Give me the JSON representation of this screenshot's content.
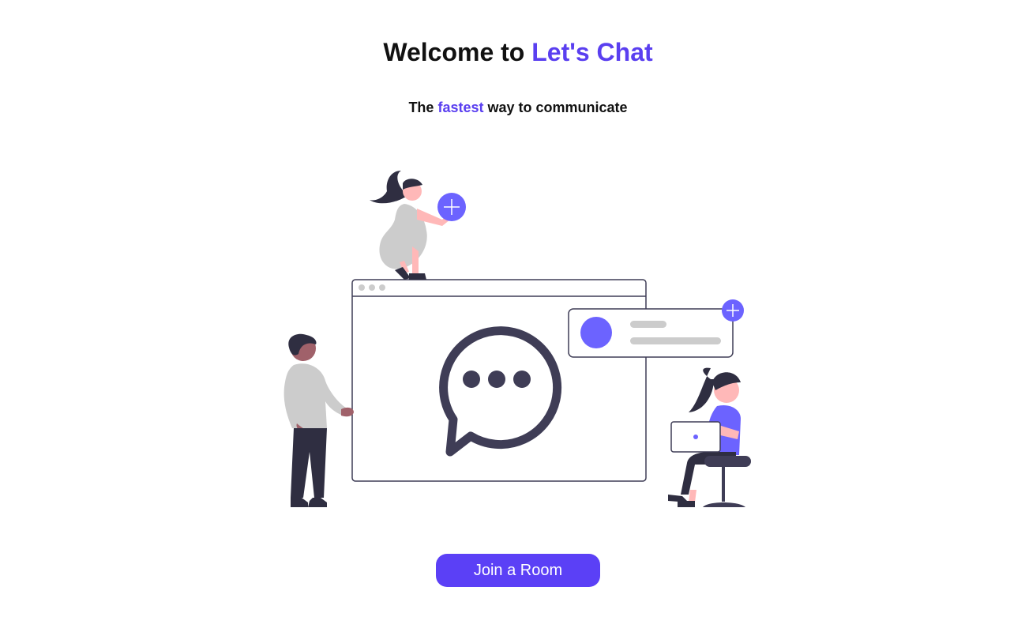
{
  "header": {
    "title_prefix": "Welcome to ",
    "title_brand": "Let's Chat",
    "tagline_start": "The ",
    "tagline_highlight": "fastest",
    "tagline_end": " way to communicate"
  },
  "colors": {
    "accent": "#5b40f6",
    "illustration_purple": "#6c63ff",
    "illustration_dark": "#3f3d56",
    "illustration_gray": "#cccccc",
    "skin": "#ffb8b8"
  },
  "illustration": {
    "icons": [
      "chat-bubble-icon",
      "add-icon",
      "user-card-icon"
    ]
  },
  "actions": {
    "join_label": "Join a Room"
  }
}
